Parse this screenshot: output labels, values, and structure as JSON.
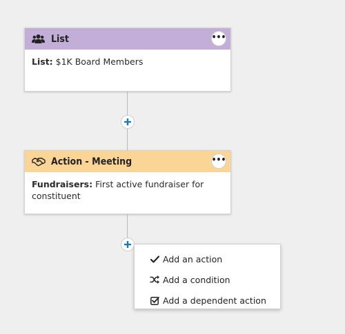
{
  "colors": {
    "list_header": "#c3aed7",
    "action_header": "#fbd596",
    "plus_accent": "#1a7ab5",
    "background": "#efefef"
  },
  "list_card": {
    "header_icon": "users-icon",
    "title": "List",
    "more_label": "•••",
    "body_label": "List:",
    "body_value": "$1K Board Members"
  },
  "action_card": {
    "header_icon": "handshake-icon",
    "title": "Action - Meeting",
    "more_label": "•••",
    "body_label": "Fundraisers:",
    "body_value": "First active fundraiser for constituent"
  },
  "add_buttons": {
    "icon": "plus-icon"
  },
  "add_menu": {
    "items": [
      {
        "icon": "check-icon",
        "label": "Add an action"
      },
      {
        "icon": "shuffle-icon",
        "label": "Add a condition"
      },
      {
        "icon": "checkbox-icon",
        "label": "Add a dependent action"
      }
    ]
  }
}
